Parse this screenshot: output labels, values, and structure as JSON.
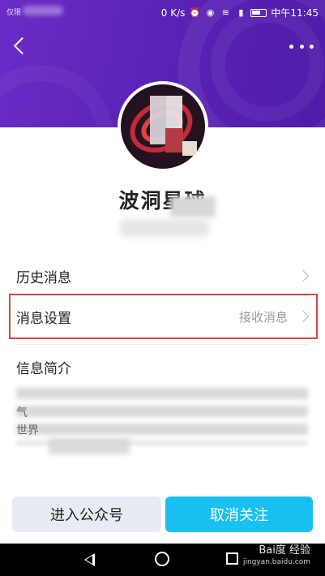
{
  "status": {
    "carrier": "仅限",
    "net_speed": "0 K/s",
    "time": "中午11:45",
    "icons": [
      "alarm-icon",
      "eye-icon",
      "wifi-icon",
      "signal-icon",
      "battery-icon"
    ]
  },
  "header": {
    "back_icon": "back-icon",
    "more_icon": "more-icon",
    "accent": "#5b23b8"
  },
  "account": {
    "name": "波洞星球",
    "subtitle": ""
  },
  "rows": {
    "history_label": "历史消息",
    "settings_label": "消息设置",
    "settings_value": "接收消息"
  },
  "intro": {
    "title": "信息简介",
    "line1": "",
    "line2": "气",
    "line3": "世界"
  },
  "buttons": {
    "enter": "进入公众号",
    "unfollow": "取消关注",
    "unfollow_color": "#19c0f0"
  },
  "watermark": {
    "main": "Bai度 经验",
    "sub": "jingyan.baidu.com"
  }
}
